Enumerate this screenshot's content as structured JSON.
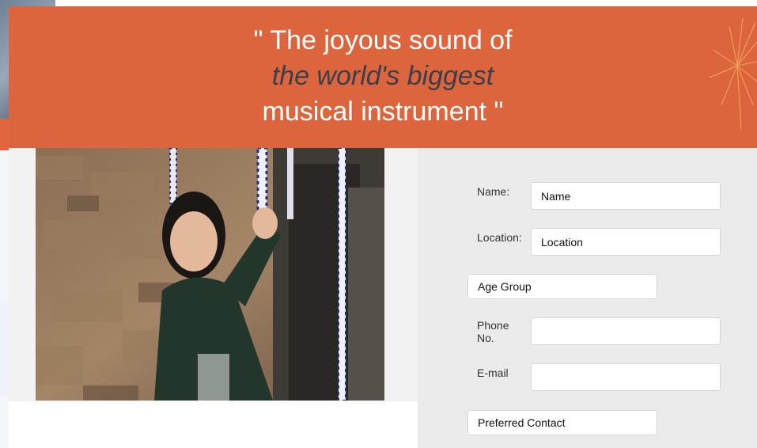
{
  "banner": {
    "quote_line1": "\" The joyous sound of",
    "quote_line2": "the world's biggest",
    "quote_line3": "musical instrument \"",
    "background_color": "#dc653d",
    "highlight_color": "#3c3f4a"
  },
  "photo": {
    "description_icon": "bell-ringer-photo"
  },
  "form": {
    "name_label": "Name:",
    "name_placeholder": "Name",
    "location_label": "Location:",
    "location_placeholder": "Location",
    "age_group_placeholder": "Age Group",
    "phone_label": "Phone No.",
    "phone_placeholder": "",
    "email_label": "E-mail",
    "email_placeholder": "",
    "preferred_contact_placeholder": "Preferred Contact"
  }
}
